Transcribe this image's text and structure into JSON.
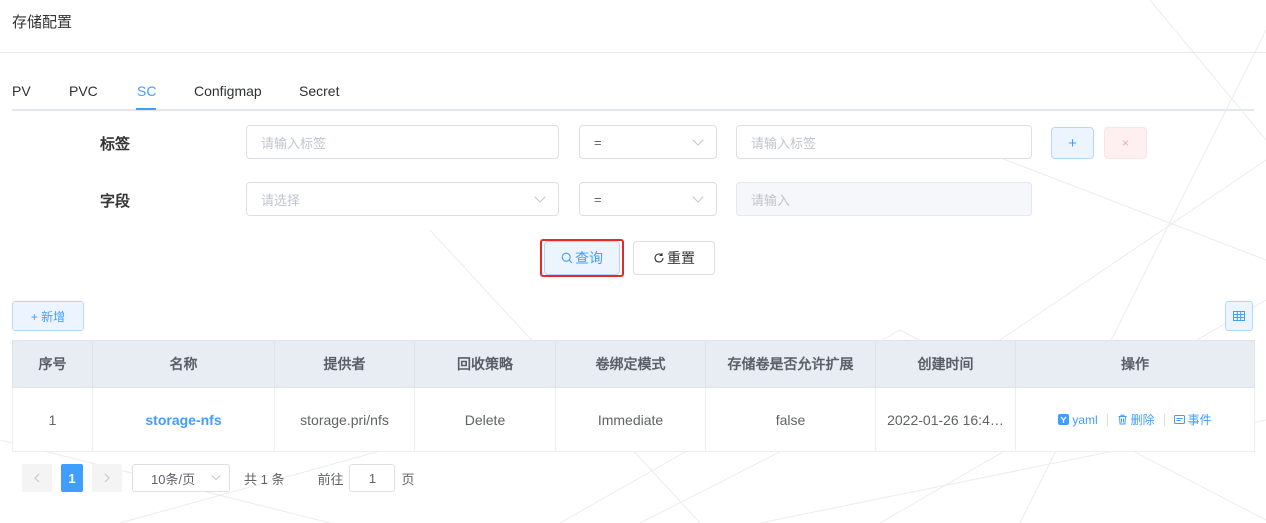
{
  "page": {
    "title": "存储配置"
  },
  "tabs": [
    {
      "label": "PV"
    },
    {
      "label": "PVC"
    },
    {
      "label": "SC",
      "active": true
    },
    {
      "label": "Configmap"
    },
    {
      "label": "Secret"
    }
  ],
  "filters": {
    "label_row": {
      "label": "标签",
      "key_placeholder": "请输入标签",
      "operator": "=",
      "value_placeholder": "请输入标签",
      "add_label": "+",
      "remove_label": "×"
    },
    "field_row": {
      "label": "字段",
      "key_placeholder": "请选择",
      "operator": "=",
      "value_placeholder": "请输入"
    },
    "query_label": "查询",
    "reset_label": "重置"
  },
  "toolbar": {
    "add_label": "+ 新增"
  },
  "table": {
    "columns": [
      "序号",
      "名称",
      "提供者",
      "回收策略",
      "卷绑定模式",
      "存储卷是否允许扩展",
      "创建时间",
      "操作"
    ],
    "rows": [
      {
        "index": "1",
        "name": "storage-nfs",
        "provisioner": "storage.pri/nfs",
        "reclaim_policy": "Delete",
        "binding_mode": "Immediate",
        "allow_expansion": "false",
        "created": "2022-01-26 16:4…",
        "actions": {
          "yaml": "yaml",
          "delete": "删除",
          "events": "事件"
        }
      }
    ]
  },
  "pagination": {
    "current_page": "1",
    "page_size": "10条/页",
    "total": "共 1 条",
    "goto_prefix": "前往",
    "goto_value": "1",
    "goto_suffix": "页"
  },
  "colors": {
    "primary": "#409eff",
    "danger_outline": "#e8292a",
    "header_bg": "#e8ecf3"
  }
}
